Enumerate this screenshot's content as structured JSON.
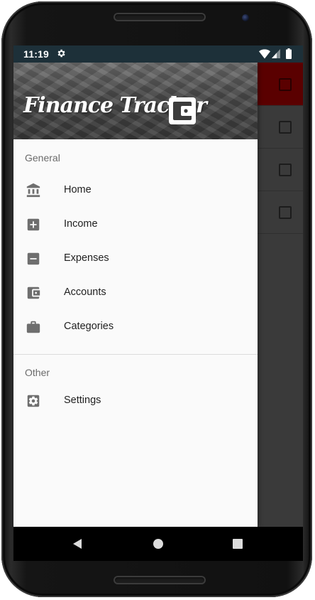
{
  "status_bar": {
    "time": "11:19",
    "icons": [
      "gear-icon",
      "wifi-icon",
      "signal-icon",
      "battery-icon"
    ],
    "background": "#1d3039"
  },
  "drawer": {
    "header": {
      "app_name": "Finance Tracker",
      "logo_icon": "wallet-icon"
    },
    "sections": [
      {
        "label": "General",
        "items": [
          {
            "label": "Home",
            "icon": "bank-icon"
          },
          {
            "label": "Income",
            "icon": "plus-box-icon"
          },
          {
            "label": "Expenses",
            "icon": "minus-box-icon"
          },
          {
            "label": "Accounts",
            "icon": "wallet-icon"
          },
          {
            "label": "Categories",
            "icon": "briefcase-icon"
          }
        ]
      },
      {
        "label": "Other",
        "items": [
          {
            "label": "Settings",
            "icon": "settings-box-icon"
          }
        ]
      }
    ]
  },
  "background_app": {
    "accent_color": "#5a0000",
    "rows": [
      "calendar-icon",
      "checkbox-icon",
      "checkbox-icon",
      "checkbox-icon"
    ]
  },
  "system_nav": {
    "buttons": [
      "back-icon",
      "home-icon",
      "recents-icon"
    ]
  },
  "colors": {
    "drawer_bg": "#fafafa",
    "icon": "#6e6e6e",
    "text": "#1f1f1f",
    "section_label": "#6b6b6b"
  }
}
